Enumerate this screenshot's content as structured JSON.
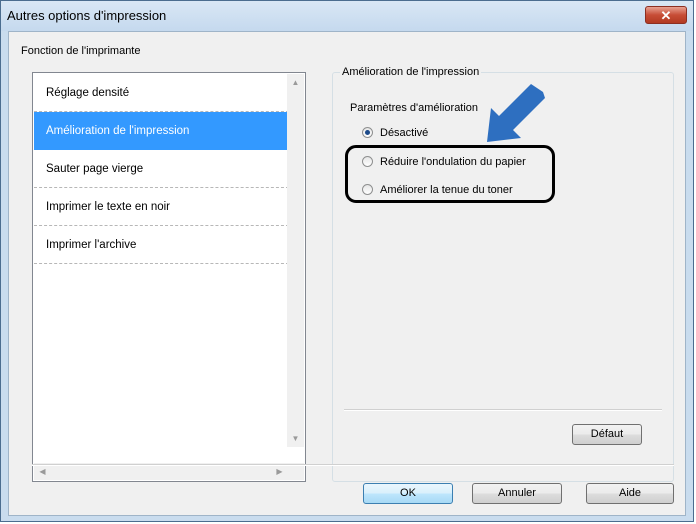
{
  "window": {
    "title": "Autres options d'impression",
    "close_glyph": "✕"
  },
  "printer_functions": {
    "label": "Fonction de l'imprimante",
    "items": [
      {
        "label": "Réglage densité",
        "selected": false
      },
      {
        "label": "Amélioration de l'impression",
        "selected": true
      },
      {
        "label": "Sauter page vierge",
        "selected": false
      },
      {
        "label": "Imprimer le texte en noir",
        "selected": false
      },
      {
        "label": "Imprimer l'archive",
        "selected": false
      }
    ]
  },
  "print_improvement": {
    "group_label": "Amélioration de l'impression",
    "settings_label": "Paramètres d'amélioration",
    "options": [
      {
        "label": "Désactivé",
        "checked": true
      },
      {
        "label": "Réduire l'ondulation du papier",
        "checked": false
      },
      {
        "label": "Améliorer la tenue du toner",
        "checked": false
      }
    ],
    "default_button": "Défaut"
  },
  "buttons": {
    "ok": "OK",
    "cancel": "Annuler",
    "help": "Aide"
  },
  "icons": {
    "pointer": "arrow-pointer-icon",
    "scroll_up": "scroll-up-icon",
    "scroll_down": "scroll-down-icon",
    "scroll_left": "scroll-left-icon",
    "scroll_right": "scroll-right-icon"
  },
  "colors": {
    "selection": "#3399ff",
    "pointer_arrow": "#2e6fc0",
    "close_button": "#c74d36"
  }
}
